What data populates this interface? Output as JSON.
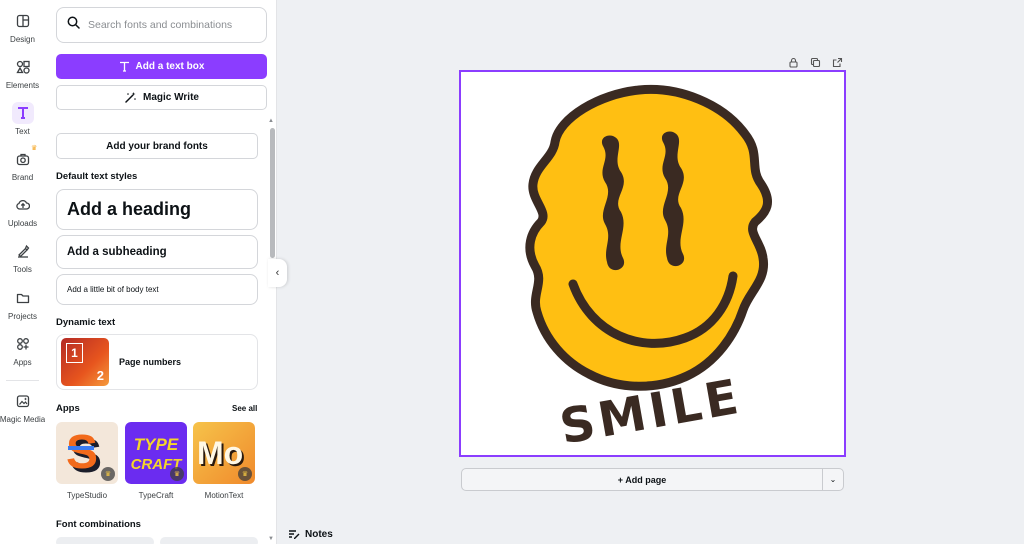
{
  "rail": {
    "items": [
      {
        "label": "Design",
        "icon": "design-icon"
      },
      {
        "label": "Elements",
        "icon": "elements-icon"
      },
      {
        "label": "Text",
        "icon": "text-icon"
      },
      {
        "label": "Brand",
        "icon": "brand-icon"
      },
      {
        "label": "Uploads",
        "icon": "uploads-icon"
      },
      {
        "label": "Tools",
        "icon": "tools-icon"
      },
      {
        "label": "Projects",
        "icon": "projects-icon"
      },
      {
        "label": "Apps",
        "icon": "apps-icon"
      },
      {
        "label": "Magic Media",
        "icon": "magic-media-icon"
      }
    ],
    "active": "Text",
    "active_color": "#8b3dff"
  },
  "panel": {
    "search_placeholder": "Search fonts and combinations",
    "add_text_box": "Add a text box",
    "magic_write": "Magic Write",
    "add_brand_fonts": "Add your brand fonts",
    "default_styles_title": "Default text styles",
    "heading": "Add a heading",
    "subheading": "Add a subheading",
    "body": "Add a little bit of body text",
    "dynamic_title": "Dynamic text",
    "page_numbers": "Page numbers",
    "page_numbers_thumb": {
      "first": "1",
      "second": "2"
    },
    "apps_title": "Apps",
    "see_all": "See all",
    "apps": [
      {
        "name": "TypeStudio",
        "glyph": "S"
      },
      {
        "name": "TypeCraft",
        "glyph_line1": "TYPE",
        "glyph_line2": "CRAFT"
      },
      {
        "name": "MotionText",
        "glyph": "Mo"
      }
    ],
    "font_combinations_title": "Font combinations"
  },
  "canvas": {
    "artwork_text": "SMILE",
    "add_page": "+ Add page",
    "notes": "Notes",
    "accent": "#8b3dff",
    "smiley_fill": "#ffbf12",
    "outline": "#3a2a22"
  }
}
